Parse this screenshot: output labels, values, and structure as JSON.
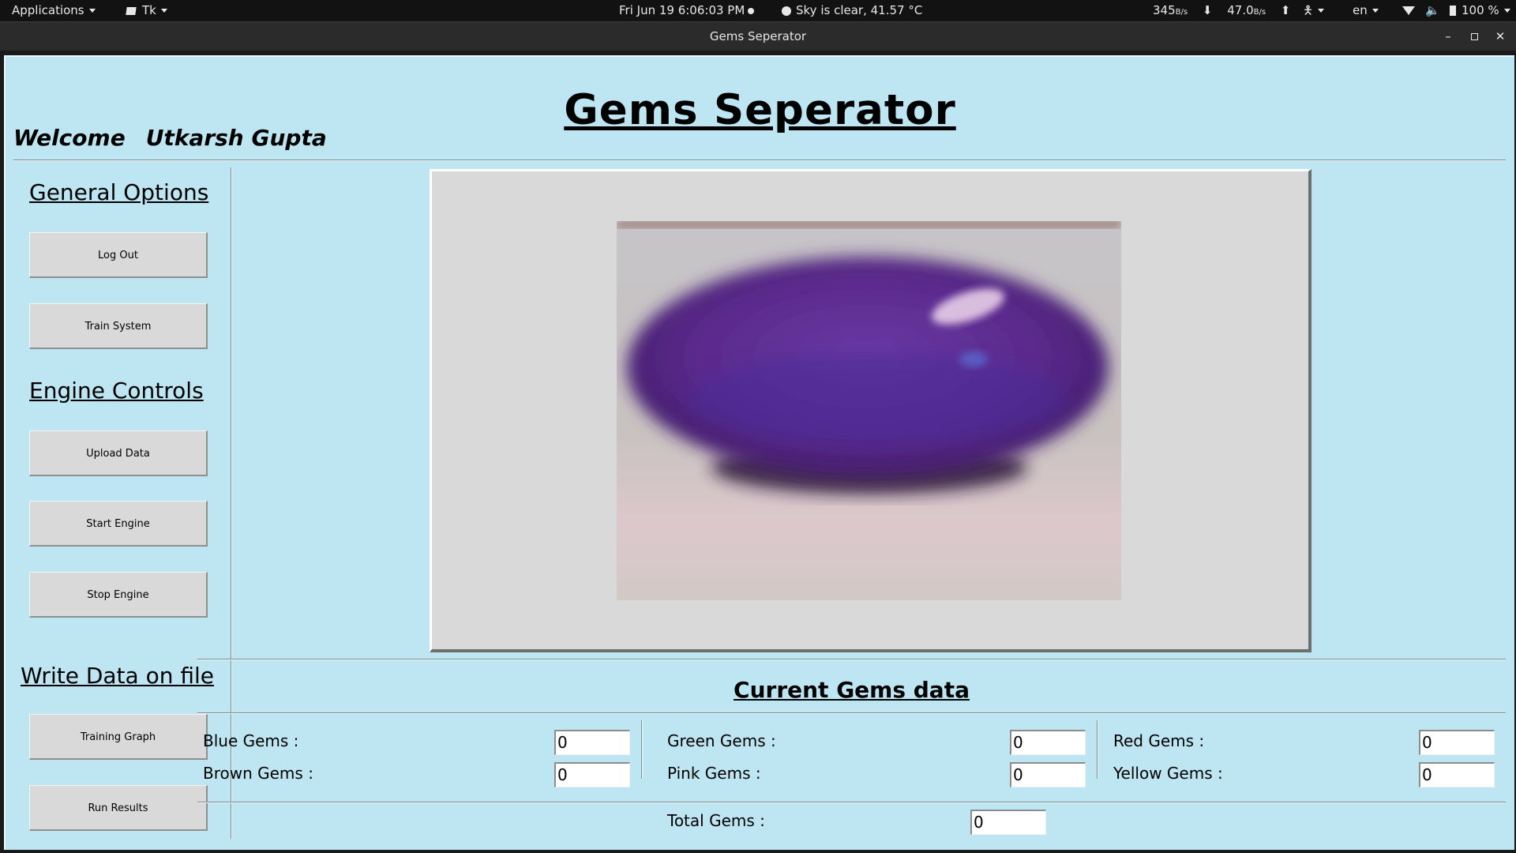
{
  "panel": {
    "applications": "Applications",
    "tk": "Tk",
    "clock": "Fri Jun 19   6:06:03 PM",
    "weather": "Sky is clear, 41.57 °C",
    "net_down": "345",
    "net_down_unit": "B/s",
    "net_up": "47.0",
    "net_up_unit": "B/s",
    "lang": "en",
    "battery": "100 %"
  },
  "window": {
    "title": "Gems Seperator"
  },
  "app": {
    "title": "Gems Seperator",
    "welcome": "Welcome",
    "user": "Utkarsh Gupta"
  },
  "sidebar": {
    "general_options": "General Options",
    "log_out": "Log Out",
    "train_system": "Train System",
    "engine_controls": "Engine Controls",
    "upload_data": "Upload Data",
    "start_engine": "Start Engine",
    "stop_engine": "Stop Engine",
    "write_data": "Write Data on file",
    "training_graph": "Training Graph",
    "run_results": "Run Results"
  },
  "gems": {
    "heading": "Current Gems data",
    "blue_label": "Blue Gems :",
    "blue_value": "0",
    "brown_label": "Brown Gems :",
    "brown_value": "0",
    "green_label": "Green Gems :",
    "green_value": "0",
    "pink_label": "Pink Gems :",
    "pink_value": "0",
    "red_label": "Red Gems :",
    "red_value": "0",
    "yellow_label": "Yellow Gems :",
    "yellow_value": "0",
    "total_label": "Total Gems :",
    "total_value": "0"
  },
  "colors": {
    "app_background": "#bde5f2",
    "button": "#d9d9d9",
    "panel": "#121212"
  }
}
